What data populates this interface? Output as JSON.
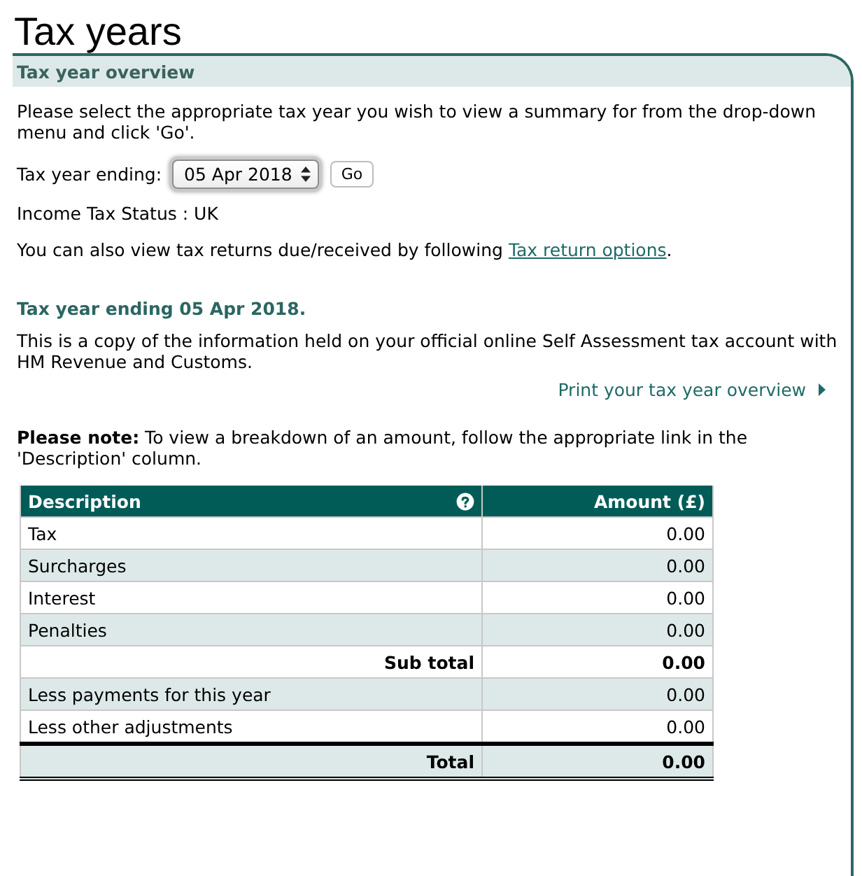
{
  "page": {
    "title": "Tax years"
  },
  "panel": {
    "title": "Tax year overview",
    "intro": "Please select the appropriate tax year you wish to view a summary for from the drop-down menu and click 'Go'.",
    "year_form": {
      "label": "Tax year ending:",
      "select_value": "05 Apr 2018",
      "button": "Go"
    },
    "status": "Income Tax Status : UK",
    "returns_note": {
      "text_before": "You can also view tax returns due/received by following ",
      "link": "Tax return options",
      "text_after": "."
    },
    "summary": {
      "heading": "Tax year ending 05 Apr 2018.",
      "text": "This is a copy of the information held on your official online Self Assessment tax account with HM Revenue and Customs.",
      "print_link": "Print your tax year overview"
    },
    "note": "**Please note:** To view a breakdown of an amount, follow the appropriate link in the 'Description' column.",
    "table": {
      "columns": [
        {
          "label": "Description",
          "help": true
        },
        {
          "label": "Amount (£)",
          "help": false
        }
      ],
      "rows": [
        {
          "kind": "item",
          "description": "Tax",
          "amount": "0.00"
        },
        {
          "kind": "item",
          "description": "Surcharges",
          "amount": "0.00"
        },
        {
          "kind": "item",
          "description": "Interest",
          "amount": "0.00"
        },
        {
          "kind": "item",
          "description": "Penalties",
          "amount": "0.00"
        },
        {
          "kind": "subtotal",
          "description": "Sub total",
          "amount": "0.00"
        },
        {
          "kind": "item",
          "description": "Less payments for this year",
          "amount": "0.00"
        },
        {
          "kind": "item",
          "description": "Less other adjustments",
          "amount": "0.00"
        },
        {
          "kind": "total",
          "description": "Total",
          "amount": "0.00"
        }
      ]
    }
  }
}
